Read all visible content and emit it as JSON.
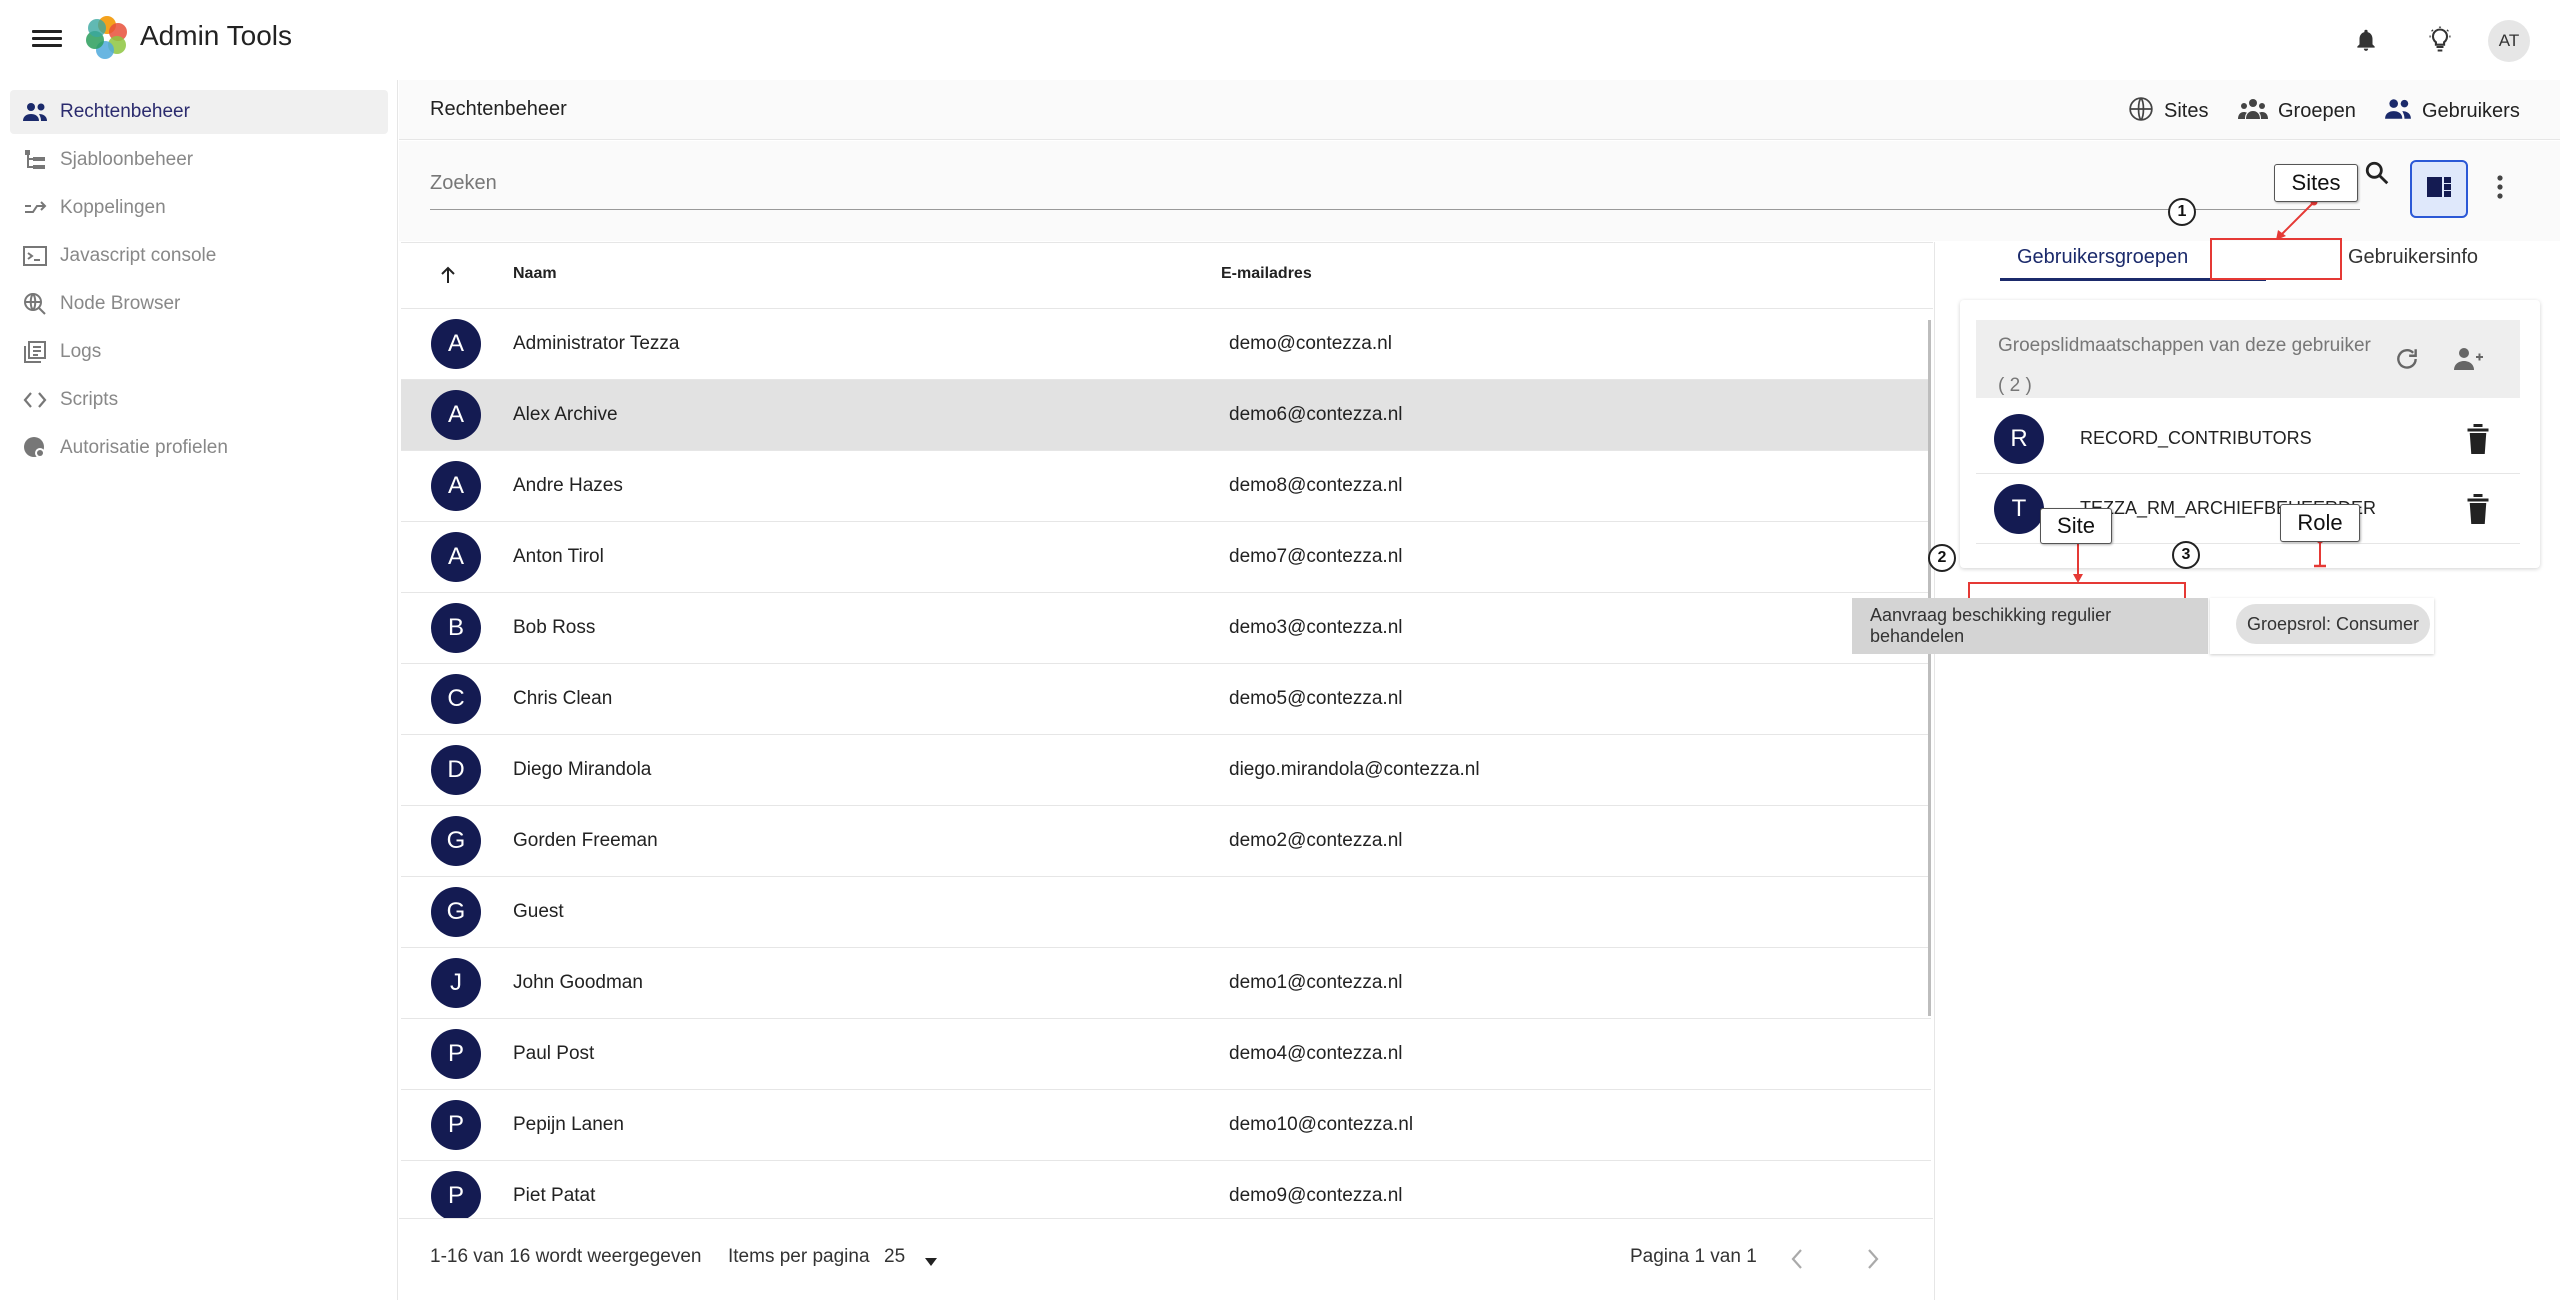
{
  "app": {
    "title": "Admin Tools",
    "user_initials": "AT"
  },
  "sidebar": {
    "items": [
      {
        "label": "Rechtenbeheer",
        "icon": "people-icon",
        "active": true
      },
      {
        "label": "Sjabloonbeheer",
        "icon": "tree-icon"
      },
      {
        "label": "Koppelingen",
        "icon": "merge-icon"
      },
      {
        "label": "Javascript console",
        "icon": "terminal-icon"
      },
      {
        "label": "Node Browser",
        "icon": "globe-search-icon"
      },
      {
        "label": "Logs",
        "icon": "logs-icon"
      },
      {
        "label": "Scripts",
        "icon": "code-icon"
      },
      {
        "label": "Autorisatie profielen",
        "icon": "settings-globe-icon"
      }
    ]
  },
  "header": {
    "page_title": "Rechtenbeheer",
    "links": {
      "sites": "Sites",
      "groups": "Groepen",
      "users": "Gebruikers"
    }
  },
  "search": {
    "placeholder": "Zoeken"
  },
  "table": {
    "columns": {
      "name": "Naam",
      "email": "E-mailadres"
    },
    "rows": [
      {
        "initial": "A",
        "name": "Administrator Tezza",
        "email": "demo@contezza.nl"
      },
      {
        "initial": "A",
        "name": "Alex Archive",
        "email": "demo6@contezza.nl",
        "selected": true
      },
      {
        "initial": "A",
        "name": "Andre Hazes",
        "email": "demo8@contezza.nl"
      },
      {
        "initial": "A",
        "name": "Anton Tirol",
        "email": "demo7@contezza.nl"
      },
      {
        "initial": "B",
        "name": "Bob Ross",
        "email": "demo3@contezza.nl"
      },
      {
        "initial": "C",
        "name": "Chris Clean",
        "email": "demo5@contezza.nl"
      },
      {
        "initial": "D",
        "name": "Diego Mirandola",
        "email": "diego.mirandola@contezza.nl"
      },
      {
        "initial": "G",
        "name": "Gorden Freeman",
        "email": "demo2@contezza.nl"
      },
      {
        "initial": "G",
        "name": "Guest",
        "email": ""
      },
      {
        "initial": "J",
        "name": "John Goodman",
        "email": "demo1@contezza.nl"
      },
      {
        "initial": "P",
        "name": "Paul Post",
        "email": "demo4@contezza.nl"
      },
      {
        "initial": "P",
        "name": "Pepijn Lanen",
        "email": "demo10@contezza.nl"
      },
      {
        "initial": "P",
        "name": "Piet Patat",
        "email": "demo9@contezza.nl"
      }
    ]
  },
  "footer": {
    "range": "1-16 van 16 wordt weergegeven",
    "per_page_label": "Items per pagina",
    "per_page_value": "25",
    "page": "Pagina 1 van 1"
  },
  "panel": {
    "tabs": {
      "groups": "Gebruikersgroepen",
      "info": "Gebruikersinfo"
    },
    "card_title": "Groepslidmaatschappen van deze gebruiker ( 2 )",
    "groups": [
      {
        "initial": "R",
        "name": "RECORD_CONTRIBUTORS"
      },
      {
        "initial": "T",
        "name": "TEZZA_RM_ARCHIEFBEHEERDER"
      }
    ]
  },
  "annotations": {
    "sites": "Sites",
    "site": "Site",
    "role": "Role",
    "n1": "1",
    "n2": "2",
    "n3": "3",
    "site_tooltip": "Aanvraag beschikking regulier behandelen",
    "role_chip": "Groepsrol: Consumer"
  }
}
